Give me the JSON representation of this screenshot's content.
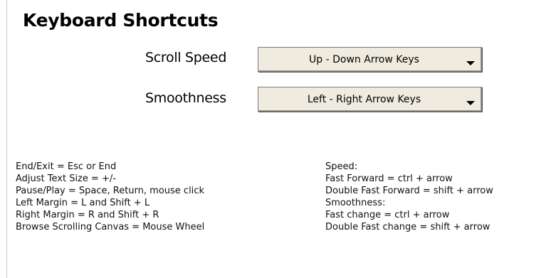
{
  "title": "Keyboard Shortcuts",
  "settings": [
    {
      "label": "Scroll Speed",
      "value": "Up - Down Arrow Keys"
    },
    {
      "label": "Smoothness",
      "value": "Left - Right Arrow Keys"
    }
  ],
  "shortcuts_left": [
    "End/Exit = Esc or End",
    "Adjust Text Size = +/-",
    "Pause/Play = Space, Return, mouse click",
    "Left Margin = L and Shift + L",
    "Right Margin = R and Shift + R",
    "Browse Scrolling Canvas = Mouse Wheel"
  ],
  "shortcuts_right": [
    "Speed:",
    "Fast Forward = ctrl + arrow",
    "Double Fast Forward = shift + arrow",
    "Smoothness:",
    "Fast change = ctrl + arrow",
    "Double Fast change = shift + arrow"
  ],
  "icons": {
    "dropdown": "chevron-down-icon"
  }
}
